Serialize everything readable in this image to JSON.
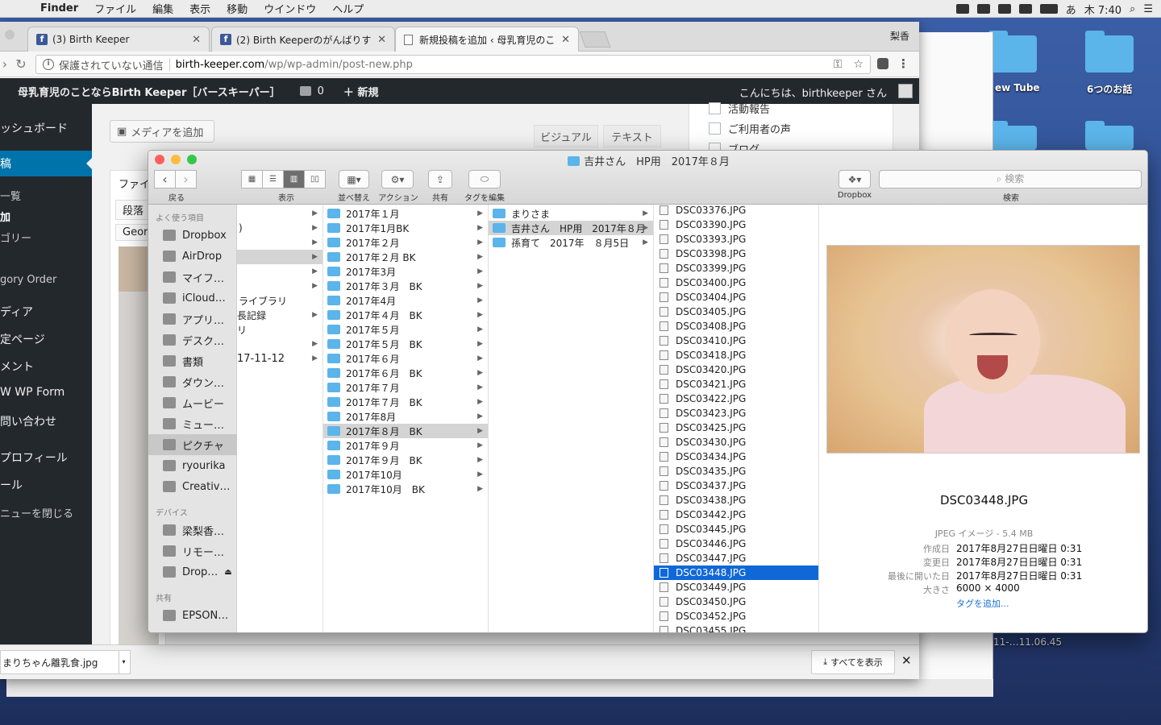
{
  "menubar": {
    "app": "Finder",
    "menus": [
      "ファイル",
      "編集",
      "表示",
      "移動",
      "ウインドウ",
      "ヘルプ"
    ],
    "input": "あ",
    "clock": "木 7:40"
  },
  "desktop": {
    "labels": [
      "ew Tube",
      "6つのお話",
      "11-…11.06.45"
    ]
  },
  "chrome": {
    "profile": "梨香",
    "tabs": [
      {
        "title": "(3) Birth Keeper"
      },
      {
        "title": "(2) Birth Keeperのがんばりすぎ"
      },
      {
        "title": "新規投稿を追加 ‹ 母乳育児のことな"
      }
    ],
    "security": "保護されていない通信",
    "domain": "birth-keeper.com",
    "path": "/wp/wp-admin/post-new.php",
    "download_file": "まりちゃん離乳食.jpg",
    "show_all": "すべてを表示"
  },
  "wp": {
    "site_name": "母乳育児のことならBirth Keeper［バースキーパー］",
    "comments_count": "0",
    "new_label": "新規",
    "howdy": "こんにちは、birthkeeper さん",
    "sidebar": {
      "dashboard": "ッシュボード",
      "posts": "稿",
      "sub_list": "一覧",
      "sub_add": "加",
      "sub_cat": "ゴリー",
      "cat_order": "gory Order",
      "media": "ディア",
      "pages": "定ページ",
      "comments": "メント",
      "mw": "W WP Form",
      "contact": "問い合わせ",
      "profile": "プロフィール",
      "tools": "ール",
      "collapse": "ニューを閉じる"
    },
    "add_media": "メディアを追加",
    "visual": "ビジュアル",
    "text": "テキスト",
    "categories": [
      "活動報告",
      "ご利用者の声",
      "ブログ"
    ],
    "editor_frag": [
      "ファイ",
      "段落",
      "Georg"
    ]
  },
  "finder": {
    "title": "吉井さん　HP用　2017年８月",
    "labels": {
      "back": "戻る",
      "view": "表示",
      "arrange": "並べ替え",
      "action": "アクション",
      "share": "共有",
      "tags": "タグを編集",
      "dropbox": "Dropbox",
      "search_label": "検索",
      "search_placeholder": "検索"
    },
    "sidebar": {
      "favorites_header": "よく使う項目",
      "favorites": [
        "Dropbox",
        "AirDrop",
        "マイフ…",
        "iCloud…",
        "アプリ…",
        "デスク…",
        "書類",
        "ダウン…",
        "ムービー",
        "ミュー…",
        "ピクチャ",
        "ryourika",
        "Creativ…"
      ],
      "devices_header": "デバイス",
      "devices": [
        "梁梨香…",
        "リモー…",
        "Drop…"
      ],
      "shared_header": "共有",
      "shared": [
        "EPSON…"
      ]
    },
    "col1": [
      "",
      "",
      "",
      "ライブラリ",
      "長記録",
      "リ",
      "17-11-12"
    ],
    "col2": [
      "2017年１月",
      "2017年1月BK",
      "2017年２月",
      "2017年２月 BK",
      "2017年3月",
      "2017年３月　BK",
      "2017年4月",
      "2017年４月　BK",
      "2017年５月",
      "2017年５月　BK",
      "2017年６月",
      "2017年６月　BK",
      "2017年７月",
      "2017年７月　BK",
      "2017年8月",
      "2017年８月　BK",
      "2017年９月",
      "2017年９月　BK",
      "2017年10月",
      "2017年10月　BK"
    ],
    "col3": [
      "まりさま",
      "吉井さん　HP用　2017年８月",
      "孫育て　2017年　８月5日"
    ],
    "col4": [
      "DSC03376.JPG",
      "DSC03390.JPG",
      "DSC03393.JPG",
      "DSC03398.JPG",
      "DSC03399.JPG",
      "DSC03400.JPG",
      "DSC03404.JPG",
      "DSC03405.JPG",
      "DSC03408.JPG",
      "DSC03410.JPG",
      "DSC03418.JPG",
      "DSC03420.JPG",
      "DSC03421.JPG",
      "DSC03422.JPG",
      "DSC03423.JPG",
      "DSC03425.JPG",
      "DSC03430.JPG",
      "DSC03434.JPG",
      "DSC03435.JPG",
      "DSC03437.JPG",
      "DSC03438.JPG",
      "DSC03442.JPG",
      "DSC03445.JPG",
      "DSC03446.JPG",
      "DSC03447.JPG",
      "DSC03448.JPG",
      "DSC03449.JPG",
      "DSC03450.JPG",
      "DSC03452.JPG",
      "DSC03455.JPG"
    ],
    "preview": {
      "name": "DSC03448.JPG",
      "kind": "JPEG イメージ - 5.4 MB",
      "created_label": "作成日",
      "created": "2017年8月27日日曜日 0:31",
      "modified_label": "変更日",
      "modified": "2017年8月27日日曜日 0:31",
      "opened_label": "最後に開いた日",
      "opened": "2017年8月27日日曜日 0:31",
      "size_label": "大きさ",
      "size": "6000 × 4000",
      "add_tags": "タグを追加..."
    }
  }
}
